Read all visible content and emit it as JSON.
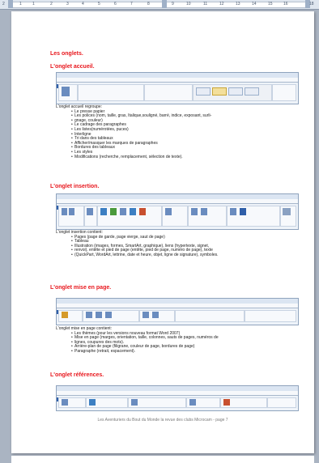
{
  "ruler": {
    "ticks": [
      "2",
      "1",
      "1",
      "2",
      "3",
      "4",
      "5",
      "6",
      "7",
      "8",
      "9",
      "10",
      "11",
      "12",
      "13",
      "14",
      "15",
      "16",
      "18"
    ]
  },
  "doc": {
    "title": "Les onglets.",
    "sections": [
      {
        "heading": "L'onglet accueil.",
        "intro": "L'onglet accueil regroupe:",
        "items": [
          "Le presse papier",
          "Les polices (nom, taille, gras, Italique,souligné, barré, indice, exposant, surli-",
          "gnage, couleur)",
          "Le cadrage des paragraphes",
          "Les listes(numérotées, puces)",
          "Interligne",
          "Tri dans des tableaux",
          "Afficher/masquer les marques de paragraphes",
          "Bordures des tableaux",
          "Les styles",
          "Modifications (recherche, remplacement, sélection de texte)."
        ]
      },
      {
        "heading": "L'onglet insertion.",
        "intro": "L'onglet insertion contient:",
        "items": [
          "Pages (page de garde, page vierge, saut de page)",
          "Tableau",
          "Illustration (images, formes, SmartArt, graphique), liens (hypertexte, signet,",
          "renvoi), entête et pied de page (entête, pied de page, numéro de page), texte",
          "(QuickPart, WordArt, lettrine, date et heure, objet, ligne de signature), symboles."
        ]
      },
      {
        "heading": "L'onglet mise en page.",
        "intro": "L'onglet mise en page contient:",
        "items": [
          "Les thèmes (pour les versions nouveau format Word 2007)",
          "Mise en page (marges, orientation, taille, colonnes, sauts de pages, numéros de",
          "lignes, coupures des mots).",
          "Arrière-plan de page (filigrane, couleur de page, bordures de page)",
          "Paragraphe (retrait, espacement)."
        ]
      },
      {
        "heading": "L'onglet références.",
        "intro": "",
        "items": []
      }
    ],
    "footer": "Les Aventuriers du Bout du Monde la revue des clubs Microcam - page 7"
  }
}
